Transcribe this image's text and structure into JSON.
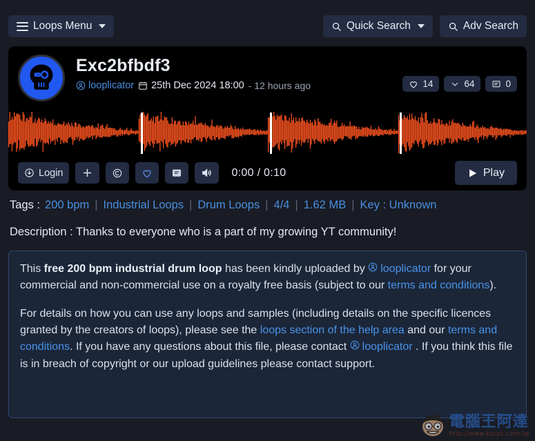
{
  "topbar": {
    "menu_label": "Loops Menu",
    "quick_search_label": "Quick Search",
    "adv_search_label": "Adv Search"
  },
  "player": {
    "title": "Exc2bfbdf3",
    "uploader": "looplicator",
    "date": "25th Dec 2024 18:00",
    "relative_time": "- 12 hours ago",
    "stats": {
      "likes": "14",
      "downloads": "64",
      "comments": "0"
    },
    "controls": {
      "login_label": "Login",
      "add_label": "",
      "licence_label": "",
      "favourite_label": "",
      "comment_label": "",
      "volume_label": "",
      "timecode": "0:00 / 0:10",
      "play_label": "Play"
    },
    "waveform": {
      "accent_color": "#f4511e",
      "marker_color": "#ffffff",
      "background_color": "#000000",
      "marker_positions_pct": [
        25.5,
        50.5,
        75.5
      ]
    }
  },
  "tags": {
    "label": "Tags :",
    "items": [
      "200 bpm",
      "Industrial Loops",
      "Drum Loops",
      "4/4",
      "1.62 MB",
      "Key : Unknown"
    ]
  },
  "description": {
    "label": "Description :",
    "text": "Thanks to everyone who is a part of my growing YT community!"
  },
  "info": {
    "p1_a": "This ",
    "p1_bold": "free 200 bpm industrial drum loop",
    "p1_b": " has been kindly uploaded by ",
    "p1_user": "looplicator",
    "p1_c": " for your commercial and non-commercial use on a royalty free basis (subject to our ",
    "p1_link": "terms and conditions",
    "p1_d": ").",
    "p2_a": "For details on how you can use any loops and samples (including details on the specific licences granted by the creators of loops), please see the ",
    "p2_link1": "loops section of the help area",
    "p2_b": " and our ",
    "p2_link2": "terms and conditions",
    "p2_c": ". If you have any questions about this file, please contact ",
    "p2_user": "looplicator",
    "p2_d": " . If you think this file is in breach of copyright or our upload guidelines please contact support."
  },
  "watermark": {
    "cn_text": "電腦王阿達",
    "url": "http://www.kocpc.com.tw"
  },
  "theme": {
    "page_bg": "#191c24",
    "card_bg": "#000000",
    "panel_bg": "#1b2638",
    "panel_border": "#2f4a74",
    "button_bg": "#232c42",
    "link_color": "#4a8fe0",
    "text_color": "#e3e8f1",
    "avatar_bg": "#2158f0"
  }
}
